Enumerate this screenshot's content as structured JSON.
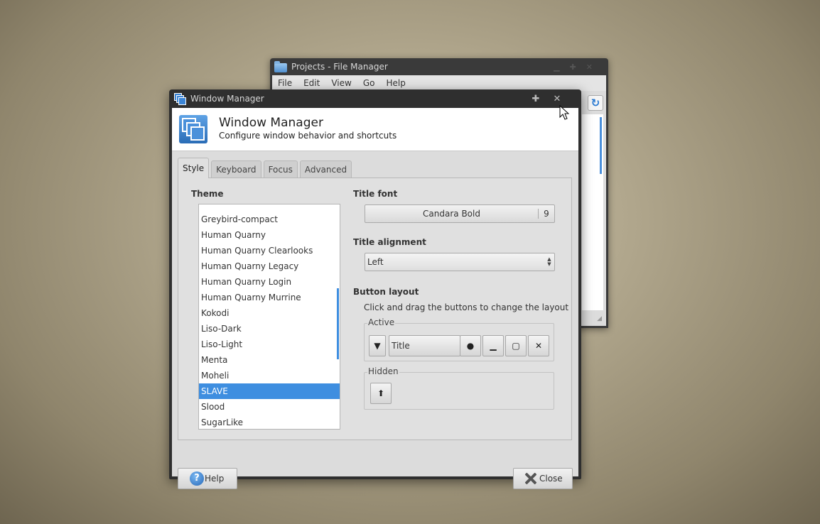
{
  "file_manager": {
    "title": "Projects - File Manager",
    "menu": [
      "File",
      "Edit",
      "View",
      "Go",
      "Help"
    ],
    "reload_icon": "reload-icon"
  },
  "dialog": {
    "title": "Window Manager",
    "header": {
      "title": "Window Manager",
      "subtitle": "Configure window behavior and shortcuts"
    },
    "tabs": [
      "Style",
      "Keyboard",
      "Focus",
      "Advanced"
    ],
    "active_tab": "Style",
    "theme": {
      "label": "Theme",
      "items": [
        "Greybird-compact",
        "Human Quarny",
        "Human Quarny Clearlooks",
        "Human Quarny Legacy",
        "Human Quarny Login",
        "Human Quarny Murrine",
        "Kokodi",
        "Liso-Dark",
        "Liso-Light",
        "Menta",
        "Moheli",
        "SLAVE",
        "Slood",
        "SugarLike"
      ],
      "selected": "SLAVE"
    },
    "title_font": {
      "label": "Title font",
      "name": "Candara Bold",
      "size": "9"
    },
    "title_alignment": {
      "label": "Title alignment",
      "value": "Left"
    },
    "button_layout": {
      "label": "Button layout",
      "hint": "Click and drag the buttons to change the layout",
      "active_label": "Active",
      "title_chip": "Title",
      "hidden_label": "Hidden"
    },
    "footer": {
      "help": "Help",
      "close": "Close"
    },
    "accent_color": "#3e8ee0"
  }
}
